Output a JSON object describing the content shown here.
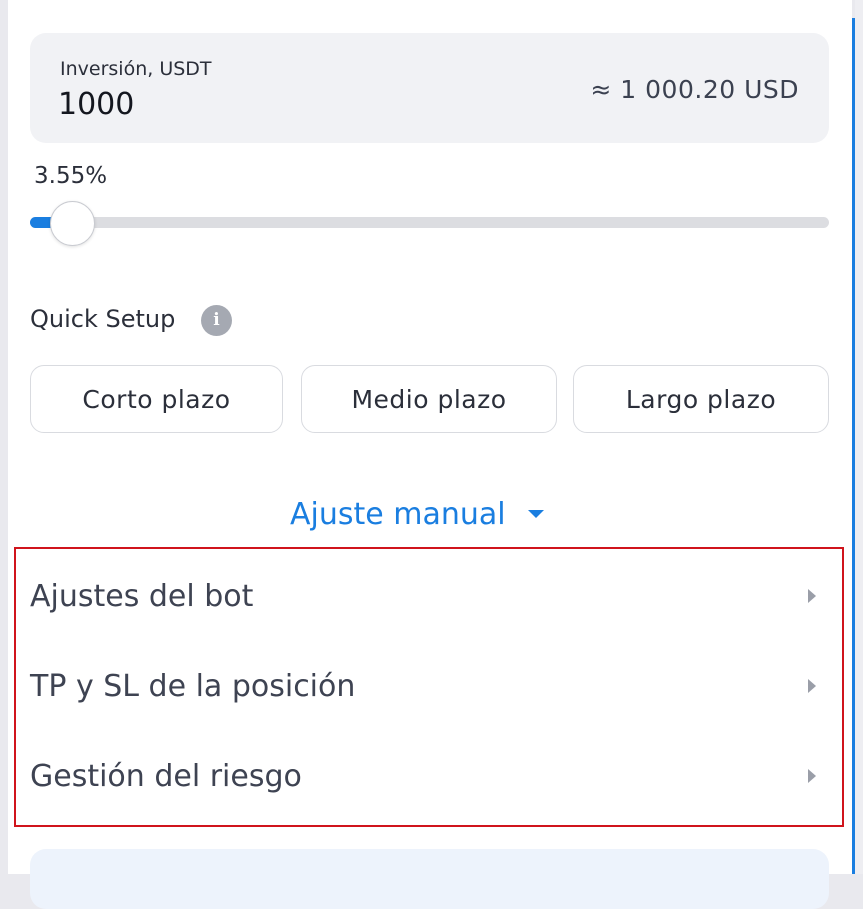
{
  "investment": {
    "label": "Inversión, USDT",
    "value": "1000",
    "conversion": "≈ 1 000.20 USD"
  },
  "slider": {
    "percent_label": "3.55%",
    "value_percent": 3.55
  },
  "quick_setup": {
    "label": "Quick Setup",
    "info_icon": "i",
    "presets": [
      "Corto plazo",
      "Medio plazo",
      "Largo plazo"
    ]
  },
  "manual": {
    "label": "Ajuste manual"
  },
  "sections": [
    {
      "label": "Ajustes del bot",
      "icon": "chevron-right-icon"
    },
    {
      "label": "TP y SL de la posición",
      "icon": "chevron-right-icon"
    },
    {
      "label": "Gestión del riesgo",
      "icon": "chevron-right-icon"
    }
  ],
  "colors": {
    "accent": "#1a7ee0",
    "highlight_border": "#d0141c"
  }
}
